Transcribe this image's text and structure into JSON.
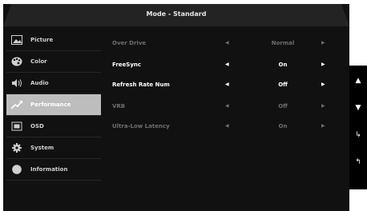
{
  "header": {
    "title": "Mode - Standard"
  },
  "sidebar": {
    "items": [
      {
        "label": "Picture",
        "icon": "picture-icon"
      },
      {
        "label": "Color",
        "icon": "palette-icon"
      },
      {
        "label": "Audio",
        "icon": "speaker-icon"
      },
      {
        "label": "Performance",
        "icon": "performance-icon",
        "active": true
      },
      {
        "label": "OSD",
        "icon": "osd-icon"
      },
      {
        "label": "System",
        "icon": "gear-icon"
      },
      {
        "label": "Information",
        "icon": "info-icon"
      }
    ]
  },
  "settings": [
    {
      "name": "Over Drive",
      "value": "Normal",
      "enabled": false
    },
    {
      "name": "FreeSync",
      "value": "On",
      "enabled": true
    },
    {
      "name": "Refresh Rate Num",
      "value": "Off",
      "enabled": true
    },
    {
      "name": "VRB",
      "value": "Off",
      "enabled": false
    },
    {
      "name": "Ultra-Low Latency",
      "value": "On",
      "enabled": false
    }
  ],
  "arrows": {
    "left": "◀",
    "right": "▶"
  },
  "keys": {
    "up": "▲",
    "down": "▼",
    "enter": "↳",
    "back": "↰"
  },
  "colors": {
    "active_bg": "#bdbdbd",
    "panel_bg": "#111111",
    "dim_text": "#6e6e6e"
  }
}
